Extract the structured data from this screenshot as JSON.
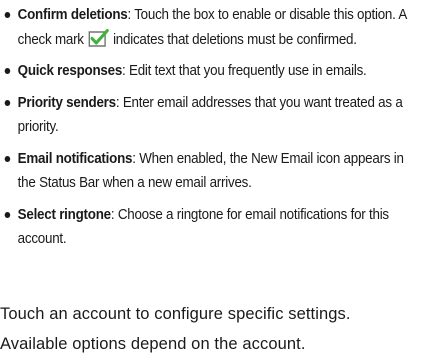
{
  "settings_options": [
    {
      "term": "Confirm deletions",
      "desc_before_icon": ": Touch the box to enable or disable this option. A check mark ",
      "icon": "checkmark-icon",
      "desc_after_icon": " indicates that deletions must be confirmed."
    },
    {
      "term": "Quick responses",
      "desc": ": Edit text that you frequently use in emails."
    },
    {
      "term": "Priority senders",
      "desc": ": Enter email addresses that you want treated as a priority."
    },
    {
      "term": "Email notifications",
      "desc": ": When enabled, the New Email icon appears in the Status Bar when a new email arrives."
    },
    {
      "term": "Select ringtone",
      "desc": ": Choose a ringtone for email notifications for this account."
    }
  ],
  "footer_text": {
    "line1": "Touch an account to configure specific settings.",
    "line2": "Available options depend on the account."
  },
  "colors": {
    "text": "#1a1a1a",
    "checkbox_border": "#6a6a6a",
    "checkmark": "#3fb33c"
  }
}
